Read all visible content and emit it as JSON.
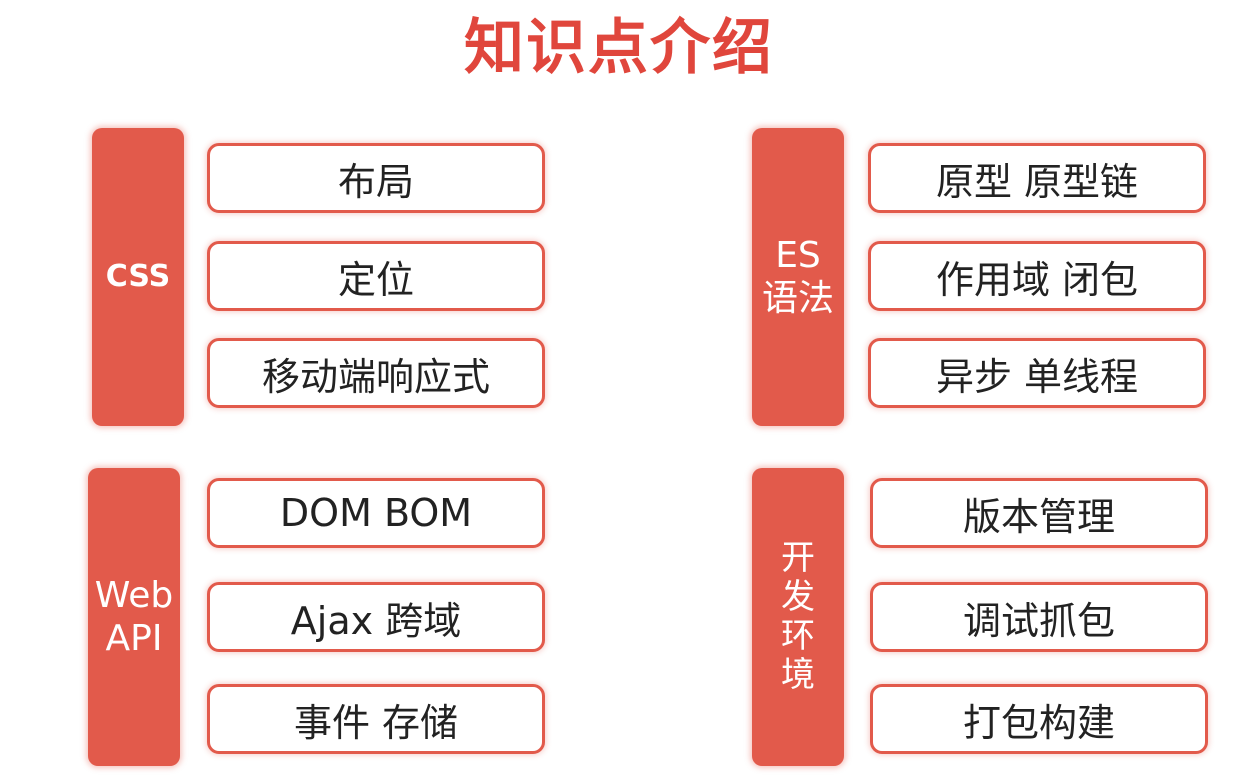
{
  "title": "知识点介绍",
  "colors": {
    "accent": "#e25a4b",
    "title": "#e0463c"
  },
  "groups": [
    {
      "category": "CSS",
      "items": [
        "布局",
        "定位",
        "移动端响应式"
      ]
    },
    {
      "category": "ES\n语法",
      "items": [
        "原型 原型链",
        "作用域 闭包",
        "异步 单线程"
      ]
    },
    {
      "category": "Web\nAPI",
      "items": [
        "DOM BOM",
        "Ajax 跨域",
        "事件 存储"
      ]
    },
    {
      "category": "开\n发\n环\n境",
      "items": [
        "版本管理",
        "调试抓包",
        "打包构建"
      ]
    }
  ]
}
